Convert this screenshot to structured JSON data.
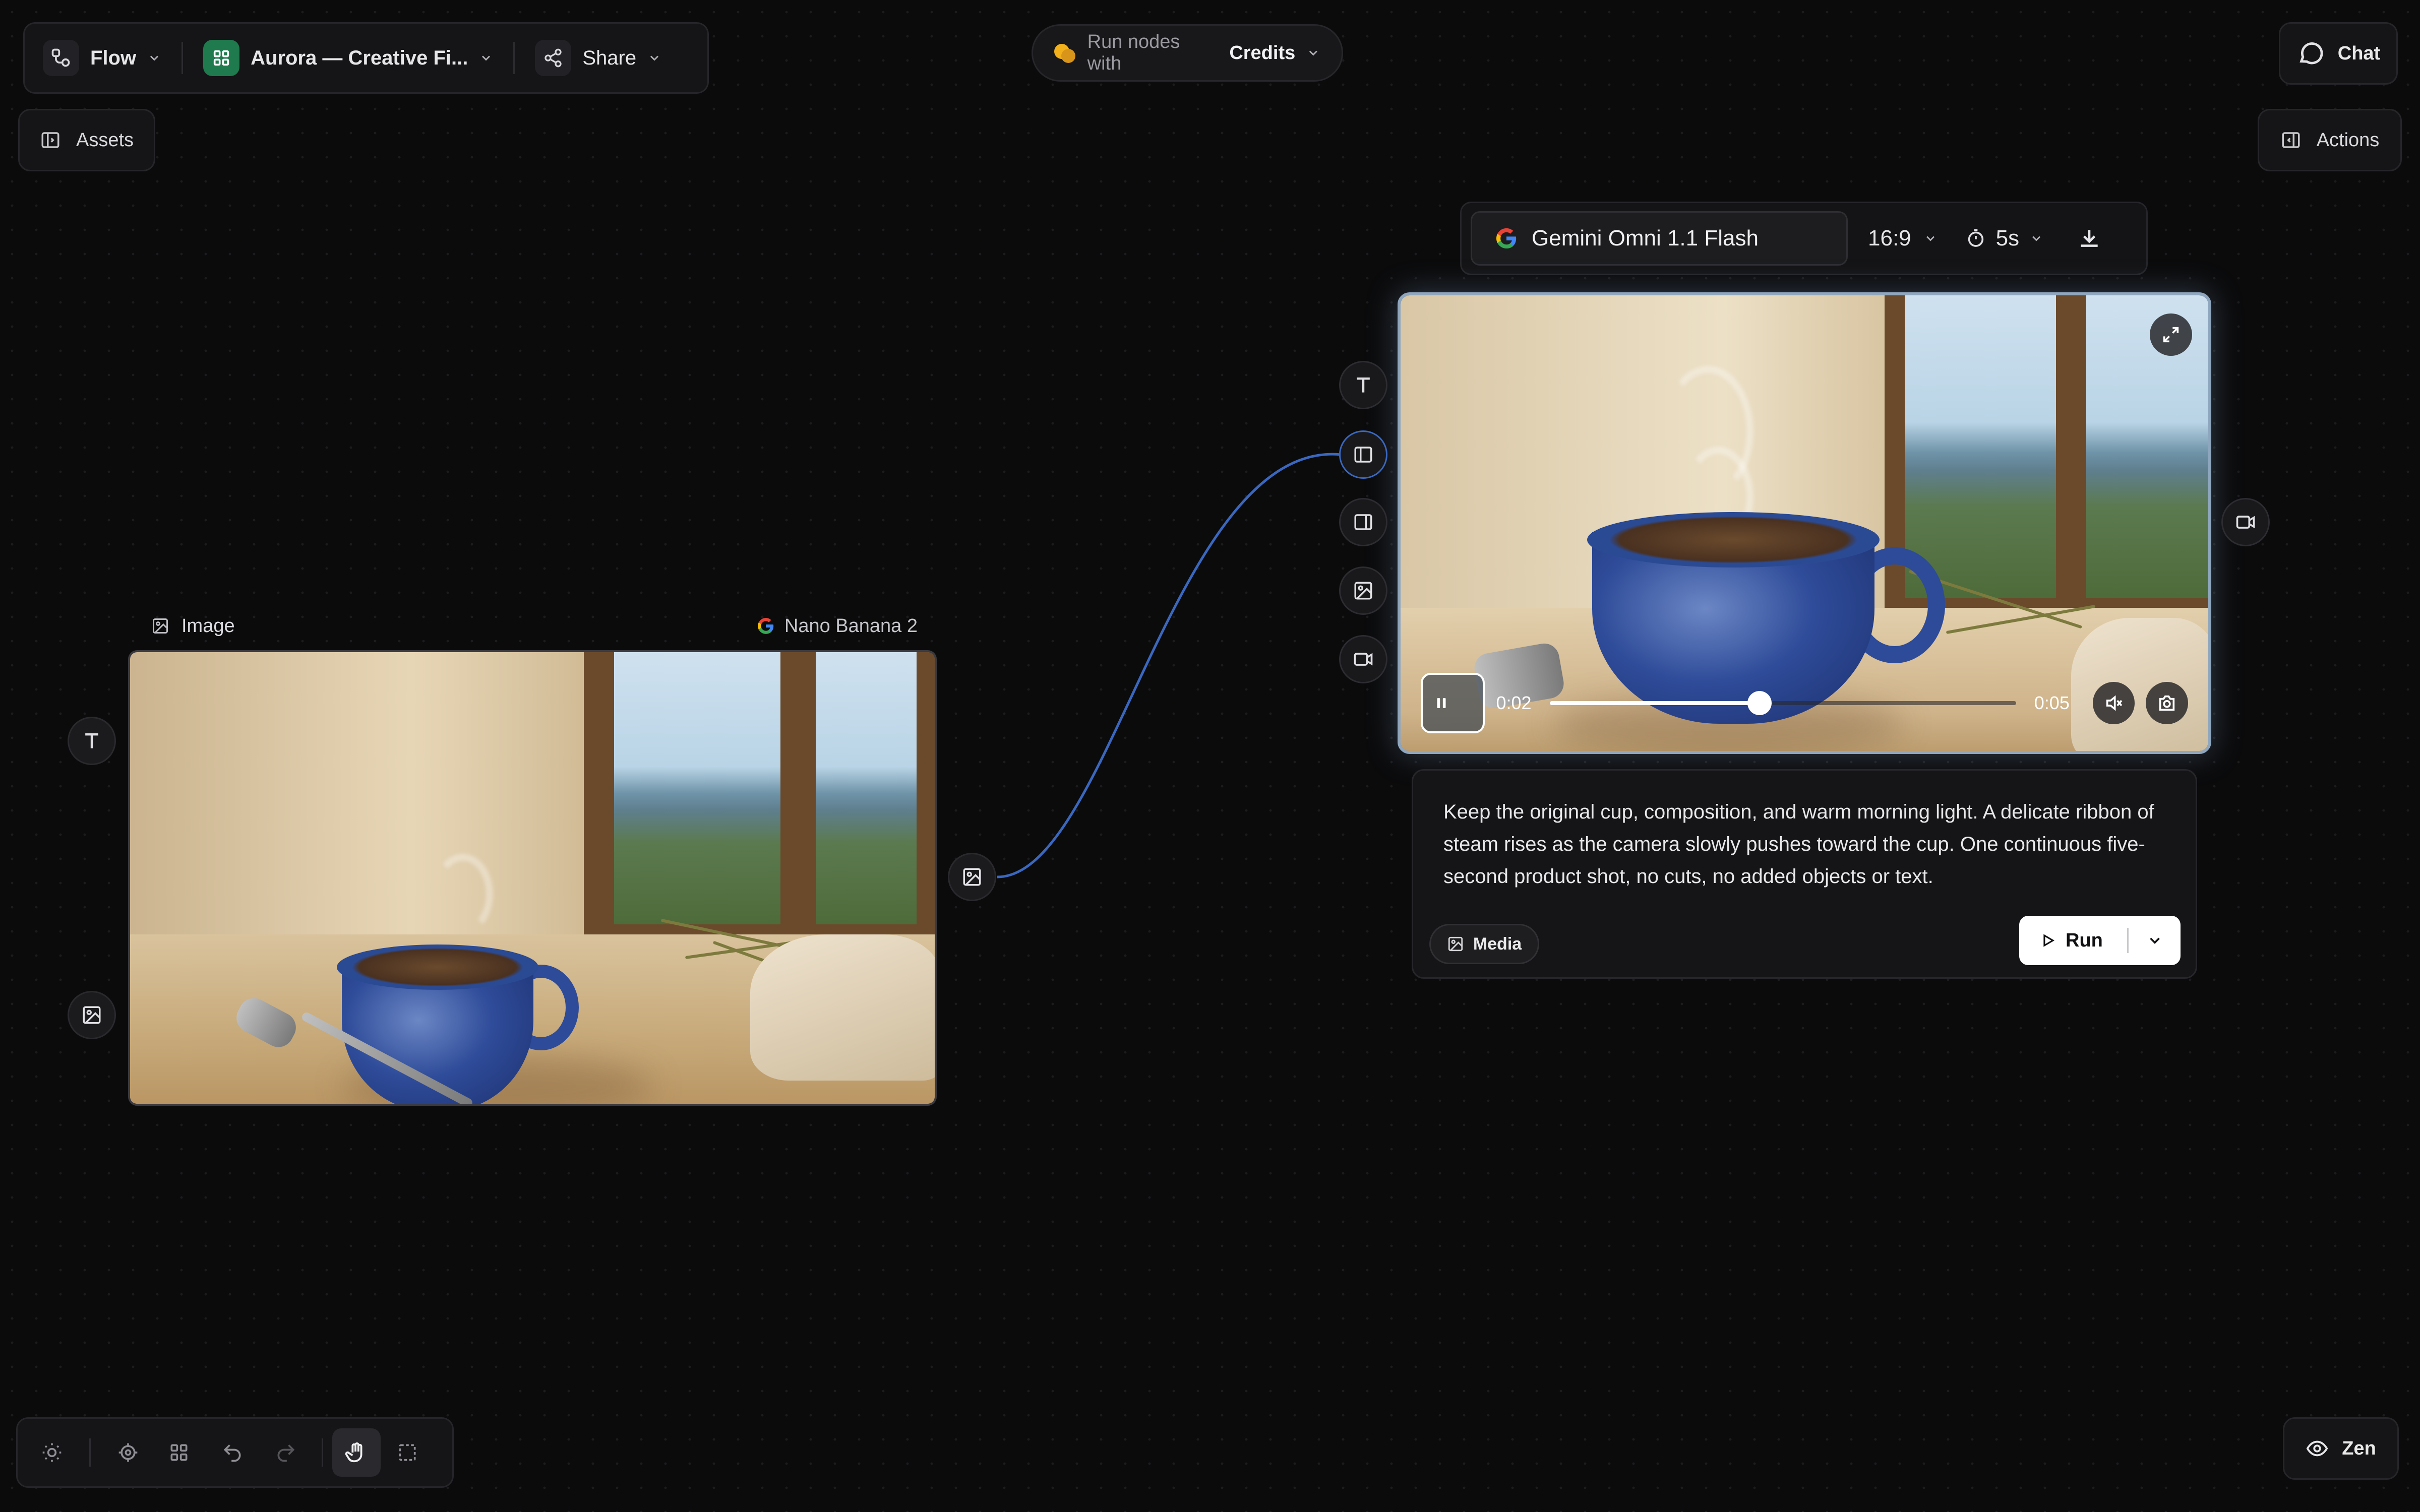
{
  "topbar": {
    "flow_label": "Flow",
    "project_label": "Aurora — Creative Fi...",
    "share_label": "Share"
  },
  "credits_bar": {
    "prefix": "Run nodes with",
    "value": "Credits"
  },
  "chat_label": "Chat",
  "assets_label": "Assets",
  "actions_label": "Actions",
  "image_node": {
    "title": "Image",
    "model": "Nano Banana 2"
  },
  "video_node": {
    "model": "Gemini Omni 1.1 Flash",
    "aspect_ratio": "16:9",
    "duration": "5s",
    "current_time": "0:02",
    "total_time": "0:05",
    "progress": 0.45
  },
  "prompt_card": {
    "text": "Keep the original cup, composition, and warm morning light. A delicate ribbon of steam rises as the camera slowly pushes toward the cup. One continuous five-second product shot, no cuts, no added objects or text.",
    "media_label": "Media",
    "run_label": "Run"
  },
  "zen_label": "Zen",
  "colors": {
    "background": "#0b0b0c",
    "accent_green": "#1f7a4d",
    "edge_blue": "#3a68c0",
    "credits_coin": "#f2b11a"
  }
}
